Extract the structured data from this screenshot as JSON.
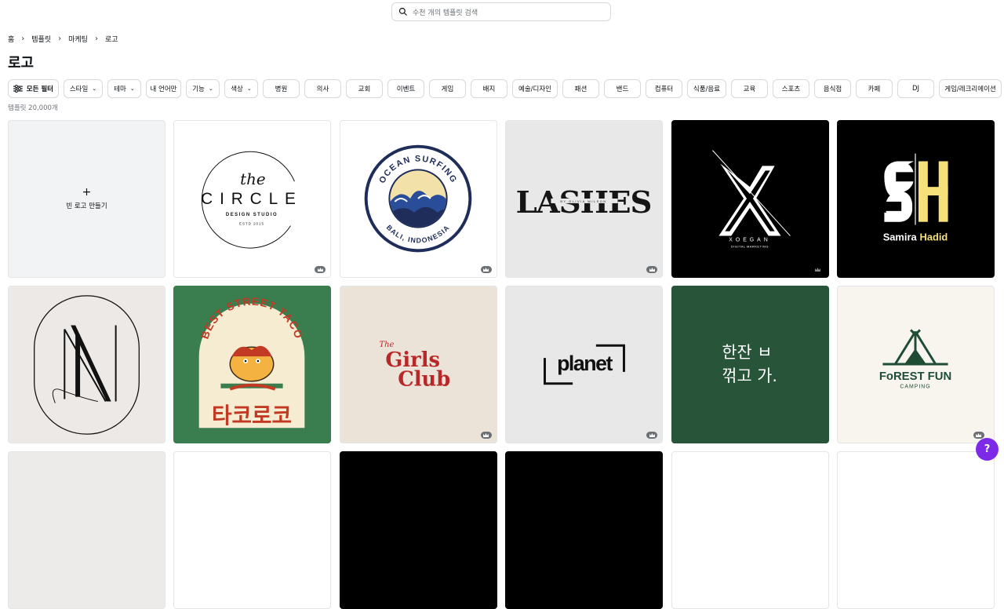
{
  "search": {
    "placeholder": "수천 개의 템플릿 검색"
  },
  "breadcrumb": [
    "홈",
    "템플릿",
    "마케팅",
    "로고"
  ],
  "page_title": "로고",
  "filters": {
    "all_filters": "모든 필터",
    "dropdowns": [
      "스타일",
      "테마",
      "내 언어만",
      "기능",
      "색상"
    ],
    "categories": [
      "병원",
      "의사",
      "교회",
      "이벤트",
      "게임",
      "배지",
      "예술/디자인",
      "패션",
      "밴드",
      "컴퓨터",
      "식품/음료",
      "교육",
      "스포츠",
      "음식점",
      "카페",
      "DJ",
      "게임/레크리에이션"
    ]
  },
  "template_count": "템플릿 20,000개",
  "blank_card": {
    "label": "빈 로고 만들기"
  },
  "cards": {
    "circle": {
      "the": "the",
      "title": "CIRCLE",
      "sub": "DESIGN STUDIO",
      "estd": "ESTD 2015"
    },
    "ocean": {
      "top": "OCEAN SURFING",
      "bottom": "BALI, INDONESIA"
    },
    "lashes": {
      "title": "LASHES",
      "sub": "BY OLIVIA WILSON"
    },
    "xoegan": {
      "name": "XOEGAN",
      "sub": "DIGITAL MARKETING"
    },
    "samira": {
      "first": "Samira",
      "last": "Hadid"
    },
    "taco": {
      "arch": "BEST STREET TACO",
      "korean": "타코로코"
    },
    "girls": {
      "the": "The",
      "line1": "Girls",
      "line2": "Club"
    },
    "planet": {
      "word": "planet"
    },
    "hanjan": {
      "line1": "한잔 ㅂ",
      "line2": "꺾고 가."
    },
    "forest": {
      "title": "FoREST FUN",
      "sub": "CAMPING"
    }
  },
  "colors": {
    "accent": "#7d2ae8",
    "green_taco": "#3a7d4f",
    "green_dark": "#28553a",
    "yellow": "#f5e07a"
  },
  "help": "?"
}
